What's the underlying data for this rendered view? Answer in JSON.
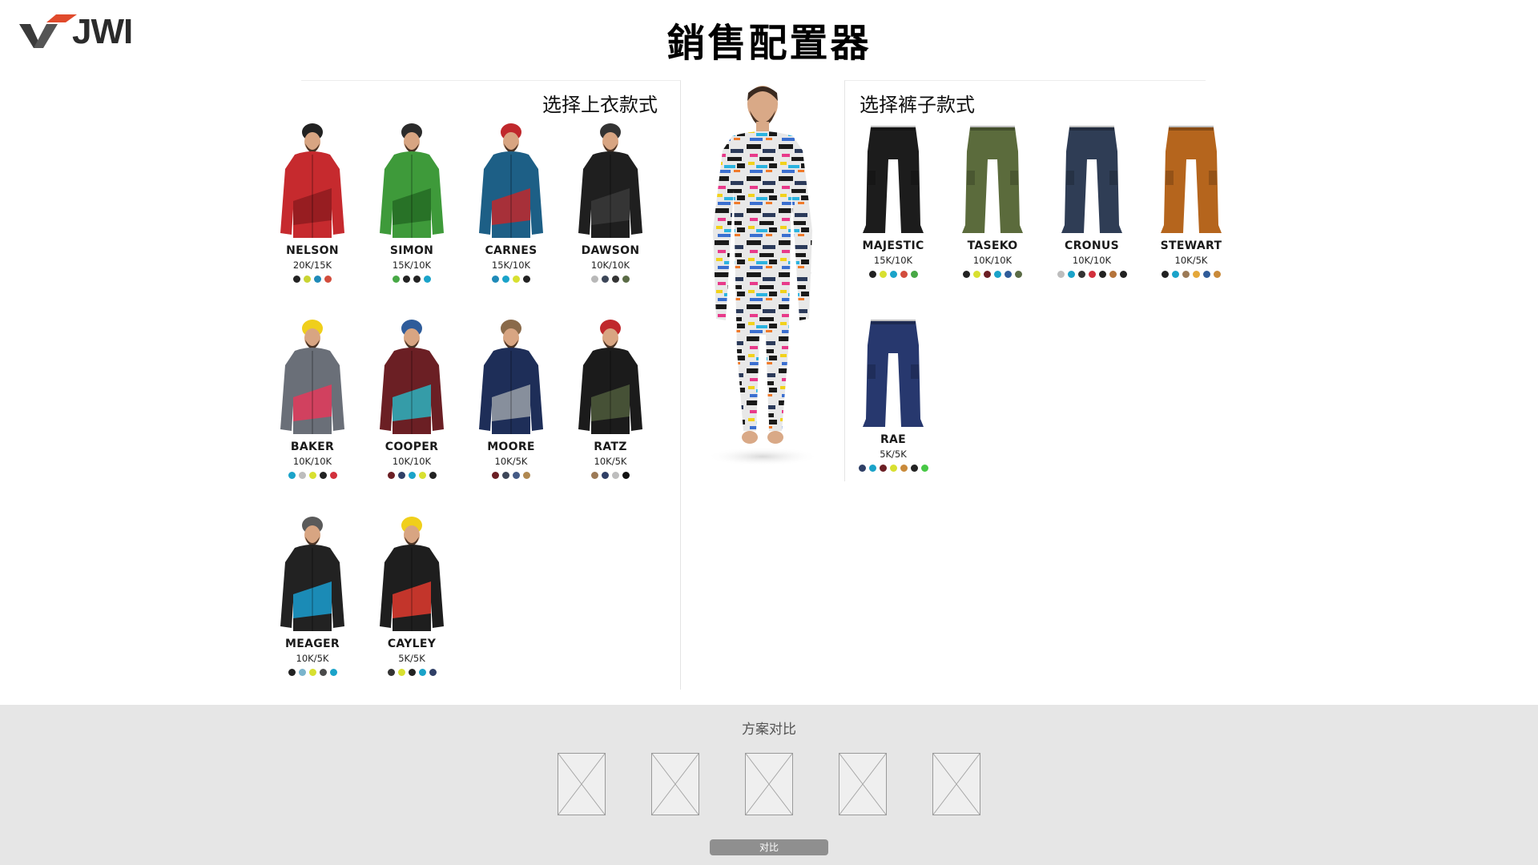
{
  "header": {
    "logo_text": "JWI",
    "title": "銷售配置器"
  },
  "jackets": {
    "title": "选择上衣款式",
    "items": [
      {
        "name": "NELSON",
        "rating": "20K/15K",
        "body": "#c62a2e",
        "trim": "#8e1b1e",
        "hat": "#222222",
        "swatches": [
          "#222222",
          "#c9d432",
          "#1f8ab8",
          "#d24c3c"
        ]
      },
      {
        "name": "SIMON",
        "rating": "15K/10K",
        "body": "#3e9a3a",
        "trim": "#256b25",
        "hat": "#2b2b2b",
        "swatches": [
          "#47a845",
          "#222222",
          "#222222",
          "#1aa3c9"
        ]
      },
      {
        "name": "CARNES",
        "rating": "15K/10K",
        "body": "#1d5f86",
        "trim": "#c0282c",
        "hat": "#c0282c",
        "swatches": [
          "#1f8ab8",
          "#1aa3c9",
          "#d8e030",
          "#222222"
        ]
      },
      {
        "name": "DAWSON",
        "rating": "10K/10K",
        "body": "#1f1f1f",
        "trim": "#3a3a3a",
        "hat": "#333333",
        "swatches": [
          "#b8b8b8",
          "#3c4658",
          "#333333",
          "#5a6b45"
        ]
      },
      {
        "name": "BAKER",
        "rating": "10K/10K",
        "body": "#6a6f78",
        "trim": "#e33a5a",
        "hat": "#f0cf1b",
        "swatches": [
          "#1aa3c9",
          "#bdbdbd",
          "#d8e030",
          "#222222",
          "#d2303c"
        ]
      },
      {
        "name": "COOPER",
        "rating": "10K/10K",
        "body": "#6b1f24",
        "trim": "#2bb3c0",
        "hat": "#2f5c9a",
        "swatches": [
          "#6b1f24",
          "#2f3f66",
          "#1aa3c9",
          "#d8e030",
          "#222222"
        ]
      },
      {
        "name": "MOORE",
        "rating": "10K/5K",
        "body": "#1e2e58",
        "trim": "#9aa0a8",
        "hat": "#8a6a4a",
        "swatches": [
          "#6b1f24",
          "#3c4658",
          "#445a86",
          "#b08850"
        ]
      },
      {
        "name": "RATZ",
        "rating": "10K/5K",
        "body": "#1b1b1b",
        "trim": "#4d5a3b",
        "hat": "#c0282c",
        "swatches": [
          "#9c7a56",
          "#2f3f66",
          "#bdbdbd",
          "#111111"
        ]
      },
      {
        "name": "MEAGER",
        "rating": "10K/5K",
        "body": "#222222",
        "trim": "#1a9ed0",
        "hat": "#5a5a5a",
        "swatches": [
          "#222222",
          "#7ab4cc",
          "#d8e030",
          "#4a4a4a",
          "#1aa3c9"
        ]
      },
      {
        "name": "CAYLEY",
        "rating": "5K/5K",
        "body": "#1e1e1e",
        "trim": "#e03a2e",
        "hat": "#f0cf1b",
        "swatches": [
          "#333333",
          "#d8e030",
          "#222222",
          "#1aa3c9",
          "#2f3f66"
        ]
      }
    ]
  },
  "pants": {
    "title": "选择裤子款式",
    "items": [
      {
        "name": "MAJESTIC",
        "rating": "15K/10K",
        "body": "#1c1c1c",
        "swatches": [
          "#222222",
          "#d8e030",
          "#1aa3c9",
          "#d24c3c",
          "#47a845"
        ]
      },
      {
        "name": "TASEKO",
        "rating": "10K/10K",
        "body": "#5b6b3c",
        "swatches": [
          "#222222",
          "#d8e030",
          "#6b1f24",
          "#1aa3c9",
          "#2f5c9a",
          "#5a6b45"
        ]
      },
      {
        "name": "CRONUS",
        "rating": "10K/10K",
        "body": "#2f3d55",
        "swatches": [
          "#bdbdbd",
          "#1aa3c9",
          "#333333",
          "#d2303c",
          "#222222",
          "#b5733a",
          "#222222"
        ]
      },
      {
        "name": "STEWART",
        "rating": "10K/5K",
        "body": "#b5651d",
        "swatches": [
          "#222222",
          "#1aa3c9",
          "#9c7a56",
          "#e5a83a",
          "#2f5c9a",
          "#c98a3a"
        ]
      },
      {
        "name": "RAE",
        "rating": "5K/5K",
        "body": "#27386e",
        "swatches": [
          "#2f3f66",
          "#1aa3c9",
          "#6b1f24",
          "#d8e030",
          "#c98a3a",
          "#222222",
          "#47c845"
        ]
      }
    ]
  },
  "compare": {
    "title": "方案对比",
    "slot_count": 5,
    "button_label": "对比"
  }
}
